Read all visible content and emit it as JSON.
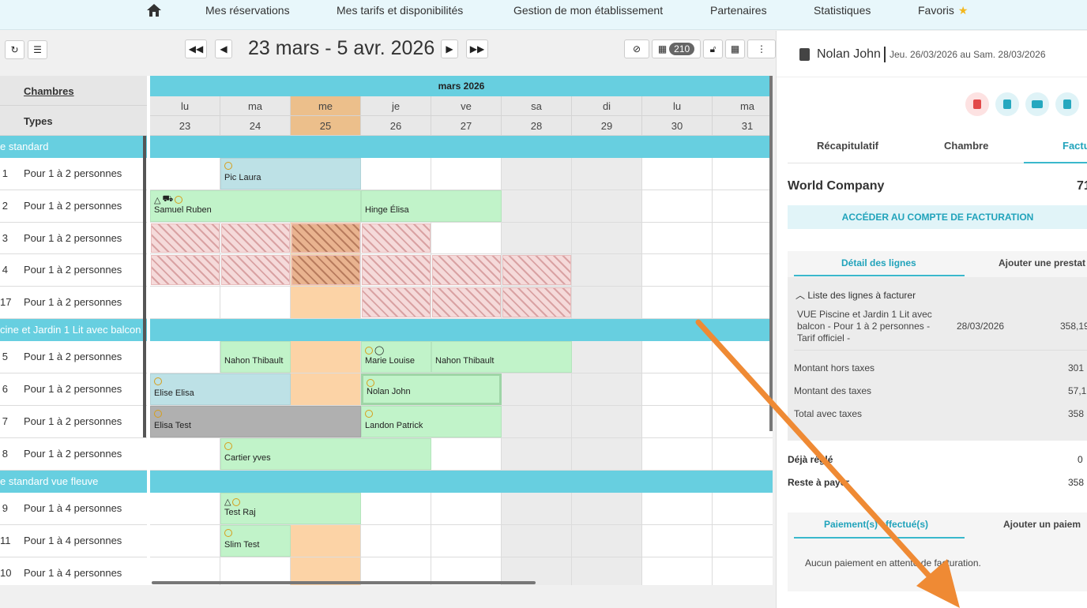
{
  "nav": {
    "items": [
      "Mes réservations",
      "Mes tarifs et disponibilités",
      "Gestion de mon établissement",
      "Partenaires",
      "Statistiques",
      "Favoris"
    ],
    "favorite_icon": "star-icon"
  },
  "toolbar": {
    "date_range": "23 mars - 5 avr. 2026",
    "badge_count": "210"
  },
  "grid": {
    "rooms_header": "Chambres",
    "types_header": "Types",
    "month": "mars 2026",
    "day_names": [
      "lu",
      "ma",
      "me",
      "je",
      "ve",
      "sa",
      "di",
      "lu",
      "ma"
    ],
    "day_numbers": [
      "23",
      "24",
      "25",
      "26",
      "27",
      "28",
      "29",
      "30",
      "31"
    ],
    "categories": [
      {
        "label": "e standard"
      },
      {
        "label": "cine et Jardin 1 Lit avec balcon"
      },
      {
        "label": "e standard vue fleuve"
      }
    ],
    "rooms": [
      {
        "num": "1",
        "type": "Pour 1 à 2 personnes"
      },
      {
        "num": "2",
        "type": "Pour 1 à 2 personnes"
      },
      {
        "num": "3",
        "type": "Pour 1 à 2 personnes"
      },
      {
        "num": "4",
        "type": "Pour 1 à 2 personnes"
      },
      {
        "num": "17",
        "type": "Pour 1 à 2 personnes"
      },
      {
        "num": "5",
        "type": "Pour 1 à 2 personnes"
      },
      {
        "num": "6",
        "type": "Pour 1 à 2 personnes"
      },
      {
        "num": "7",
        "type": "Pour 1 à 2 personnes"
      },
      {
        "num": "8",
        "type": "Pour 1 à 2 personnes"
      },
      {
        "num": "9",
        "type": "Pour 1 à 4 personnes"
      },
      {
        "num": "11",
        "type": "Pour 1 à 4 personnes"
      },
      {
        "num": "10",
        "type": "Pour 1 à 4 personnes"
      }
    ],
    "reservations": [
      {
        "name": "Pic Laura"
      },
      {
        "name": "Samuel Ruben"
      },
      {
        "name": "Hinge Élisa"
      },
      {
        "name": "Nahon Thibault"
      },
      {
        "name": "Marie Louise"
      },
      {
        "name": "Nahon Thibault"
      },
      {
        "name": "Elise Elisa"
      },
      {
        "name": "Nolan John"
      },
      {
        "name": "Elisa Test"
      },
      {
        "name": "Landon Patrick"
      },
      {
        "name": "Cartier yves"
      },
      {
        "name": "Test Raj"
      },
      {
        "name": "Slim Test"
      }
    ]
  },
  "panel": {
    "guest": "Nolan John",
    "date_range": "Jeu. 26/03/2026 au Sam. 28/03/2026",
    "tabs": [
      "Récapitulatif",
      "Chambre",
      "Factur"
    ],
    "company": "World Company",
    "company_amount": "71",
    "billing_button": "ACCÉDER AU COMPTE DE FACTURATION",
    "subtabs": [
      "Détail des lignes",
      "Ajouter une prestat"
    ],
    "list_toggle": "Liste des lignes à facturer",
    "line": {
      "description": "VUE Piscine et Jardin 1 Lit avec balcon - Pour 1 à 2 personnes - Tarif officiel -",
      "date": "28/03/2026",
      "amount": "358,19"
    },
    "totals": [
      {
        "label": "Montant hors taxes",
        "value": "301"
      },
      {
        "label": "Montant des taxes",
        "value": "57,1"
      },
      {
        "label": "Total avec taxes",
        "value": "358"
      }
    ],
    "paid_label": "Déjà réglé",
    "paid_value": "0",
    "remaining_label": "Reste à payer",
    "remaining_value": "358",
    "payment_tabs": [
      "Paiement(s) effectué(s)",
      "Ajouter un paiem"
    ],
    "payment_message": "Aucun paiement en attente de facturation."
  },
  "colors": {
    "accent": "#67cfe0",
    "arrow": "#ef8a34"
  }
}
